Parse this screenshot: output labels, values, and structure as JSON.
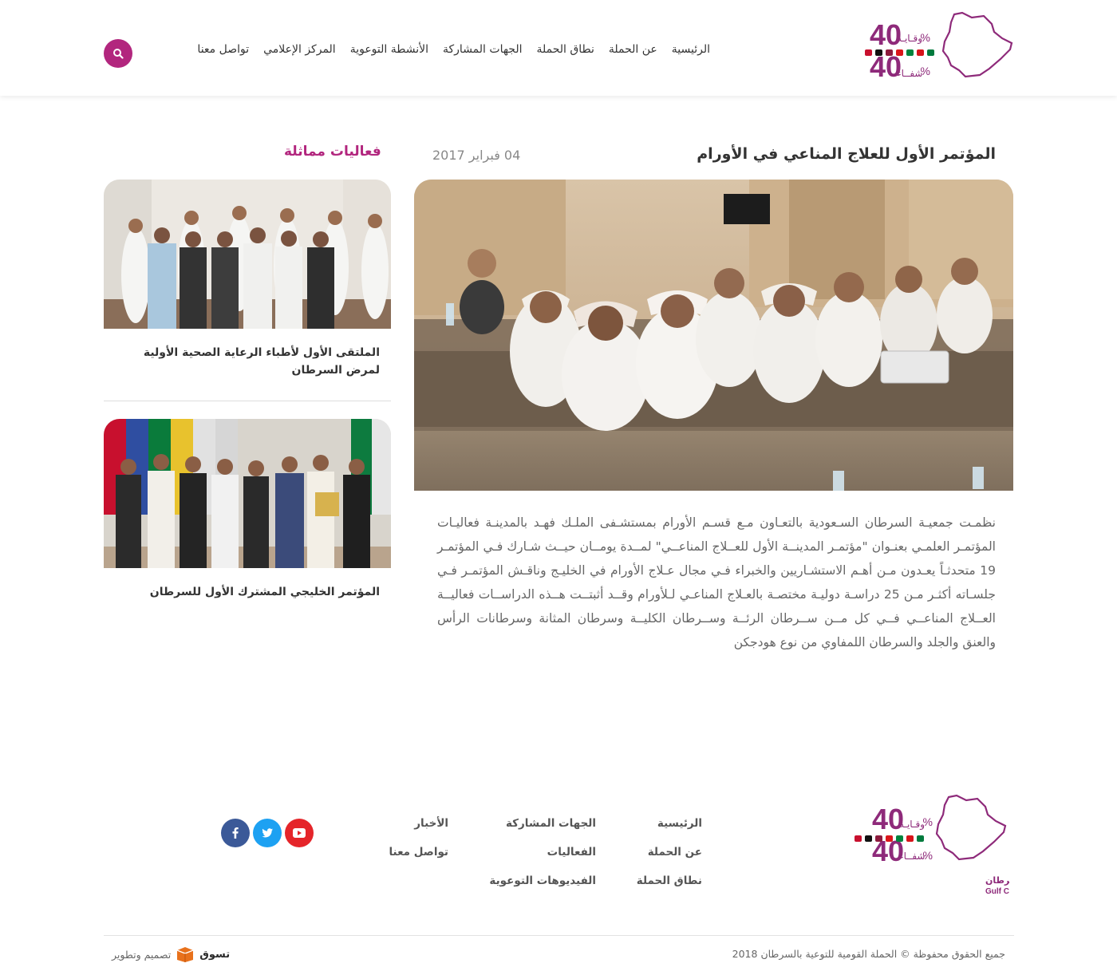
{
  "header": {
    "logo": {
      "number": "40",
      "word_top": "وقـايـة",
      "word_bottom": "شفــاء"
    },
    "nav": [
      "الرئيسية",
      "عن الحملة",
      "نطاق الحملة",
      "الجهات المشاركة",
      "الأنشطة التوعوية",
      "المركز الإعلامي",
      "تواصل معنا"
    ],
    "search_icon": "search-icon"
  },
  "article": {
    "title": "المؤتمر الأول للعلاج المناعي في الأورام",
    "date": "04 فبراير 2017",
    "body": "نظمـت جمعيـة السرطان السـعودية بالتعـاون مـع قسـم الأورام بمستشـفى الملـك فهـد بالمدينـة فعاليـات المؤتمـر العلمـي بعنـوان \"مؤتمـر المدينــة الأول للعــلاج المناعــي\" لمــدة يومــان حيــث شـارك فـي المؤتمـر 19 متحدثـاً يعـدون مـن أهـم الاستشـاريين والخبراء فـي مجال عـلاج الأورام في الخليـج وناقـش المؤتمـر فـي جلسـاته أكثـر مـن 25 دراسـة دوليـة مختصـة بالعـلاج المناعـي لـلأورام وقــد أثبتــت هــذه الدراســات فعاليــة العــلاج المناعــي فــي كل مــن ســرطان الرئــة وســرطان الكليــة وسرطان المثانة وسرطانات الرأس والعنق والجلد والسرطان اللمفاوي من نوع هودجكن"
  },
  "related": {
    "heading": "فعاليات مماثلة",
    "items": [
      {
        "title": "الملتقى الأول لأطباء الرعاية الصحية الأولية لمرض السرطان"
      },
      {
        "title": "المؤتمر الخليجي المشترك الأول للسرطان"
      }
    ]
  },
  "footer": {
    "logo": {
      "number": "40",
      "word_top": "وقـايـة",
      "word_bottom": "شفــاء",
      "name_ar": "الحملة الخليجية للتوعية بالسرطان",
      "name_en": "Gulf Campaign for Cancer Awareness"
    },
    "col1": [
      "الرئيسية",
      "عن الحملة",
      "نطاق الحملة"
    ],
    "col2": [
      "الجهات المشاركة",
      "الفعاليات",
      "الفيديوهات التوعوية"
    ],
    "col3": [
      "الأخبار",
      "تواصل معنا"
    ],
    "social": [
      {
        "icon": "youtube-icon",
        "color": "#e5252a"
      },
      {
        "icon": "twitter-icon",
        "color": "#1da1f2"
      },
      {
        "icon": "facebook-icon",
        "color": "#3b5998"
      }
    ],
    "copyright": "جميع الحقوق محفوظة © الحملة القومية للتوعية بالسرطان 2018",
    "credits_label": "تصميم وتطوير",
    "credits_brand": "تسوق"
  },
  "colors": {
    "accent": "#b2267e",
    "text_dark": "#333333",
    "text_muted": "#666666"
  }
}
